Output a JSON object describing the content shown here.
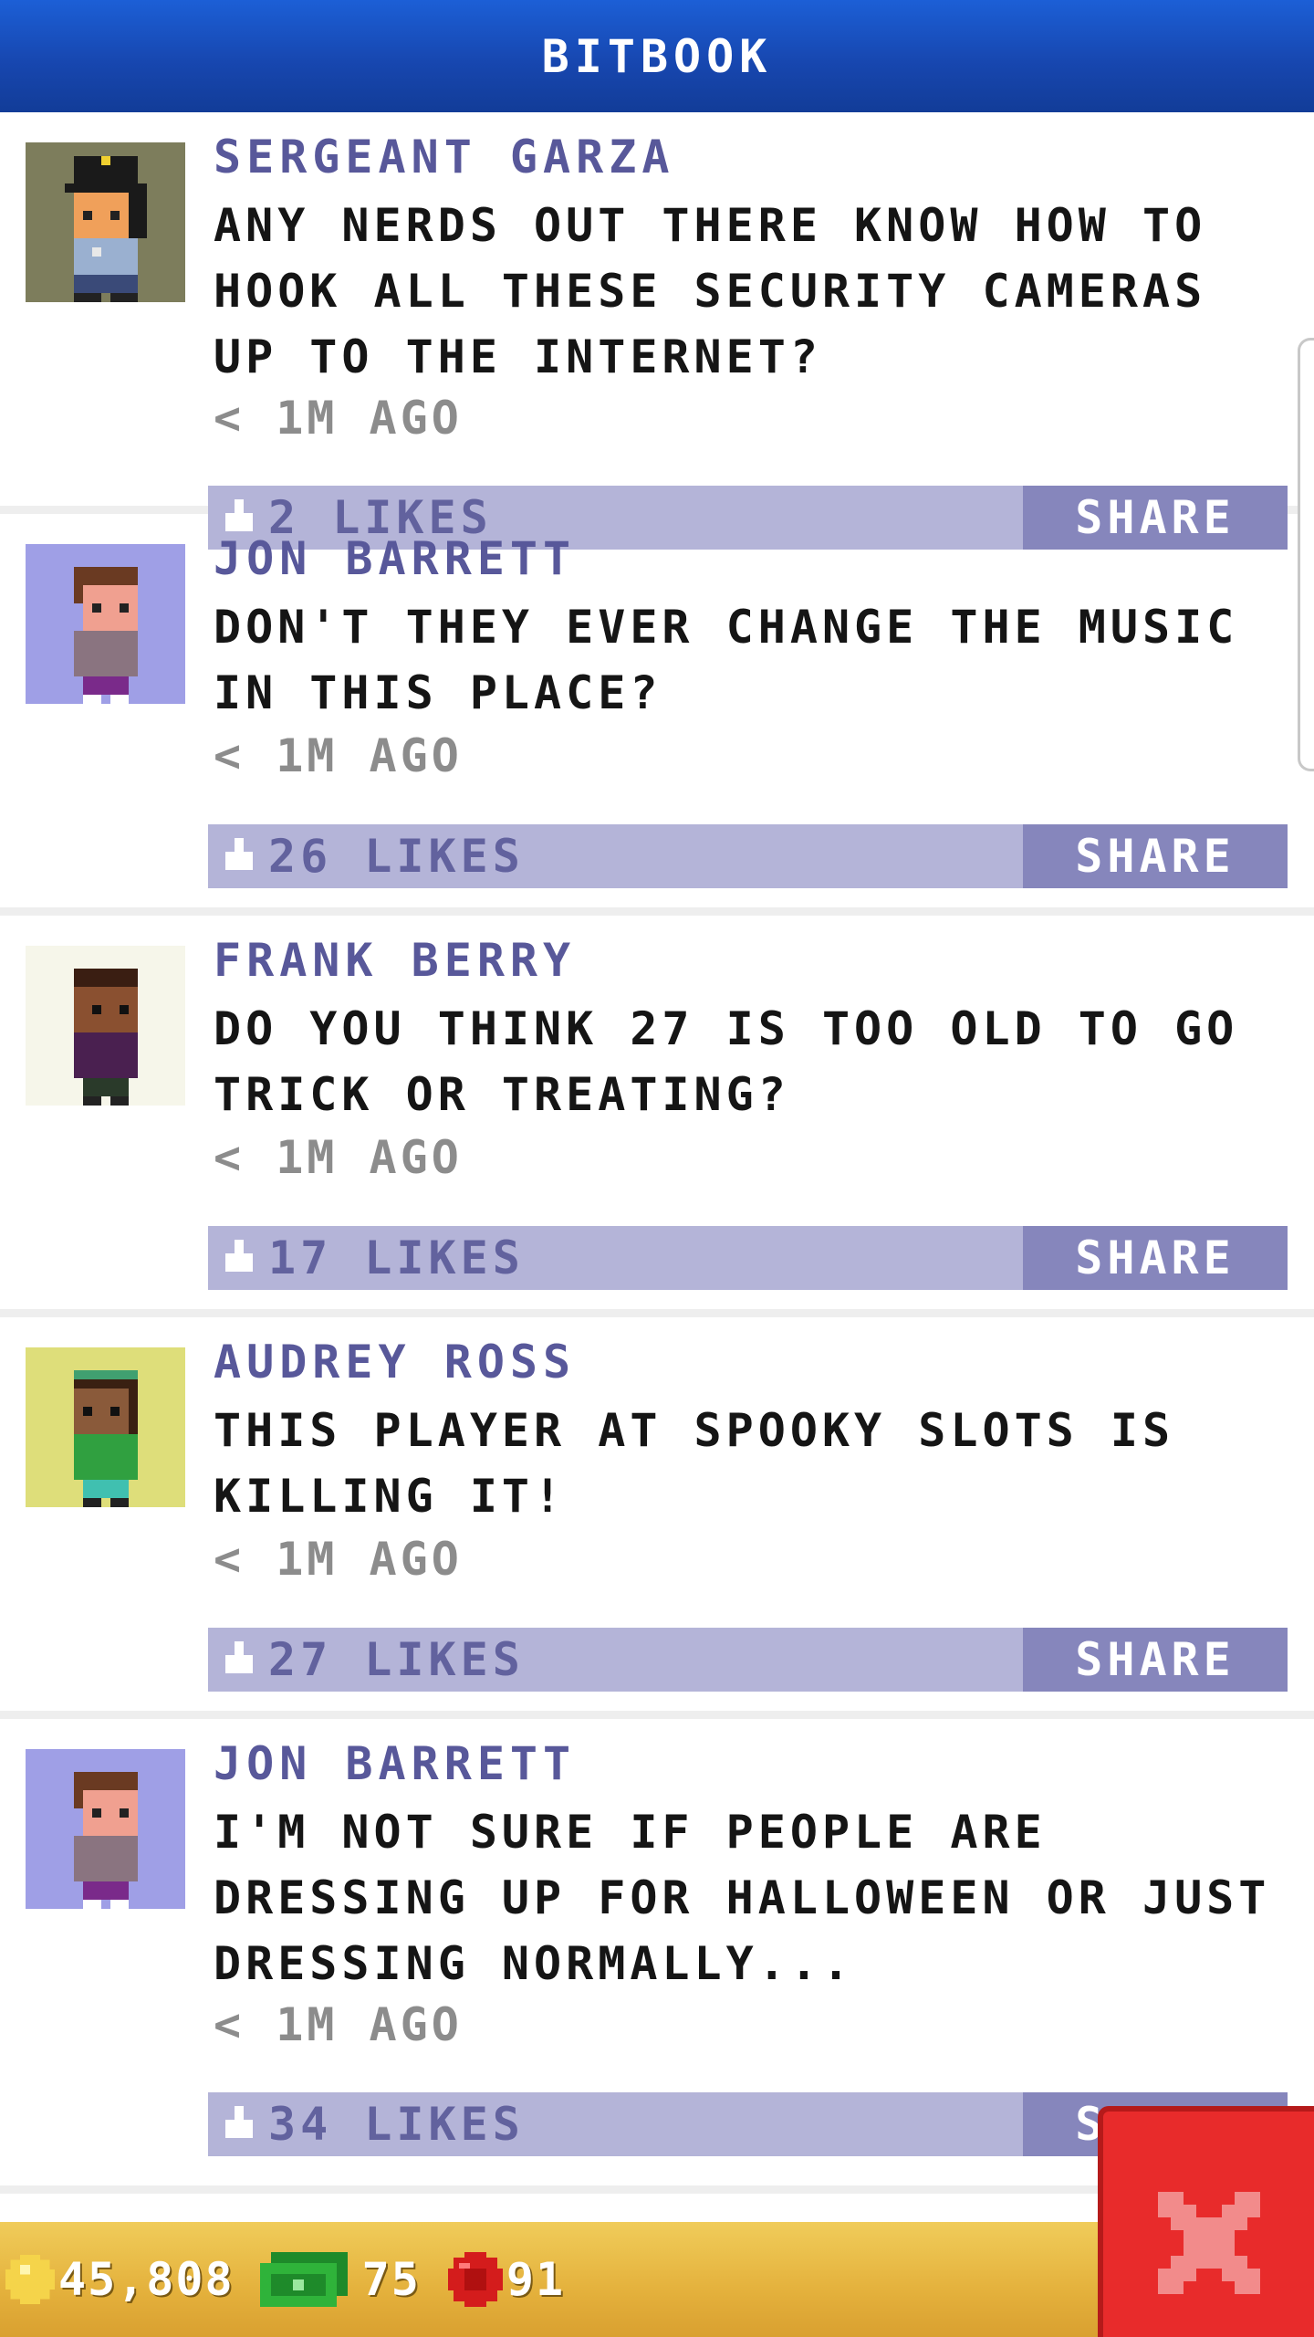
{
  "app": {
    "title": "BITBOOK"
  },
  "posts": [
    {
      "author": "SERGEANT GARZA",
      "message": "ANY NERDS OUT THERE KNOW HOW TO HOOK ALL THESE SECURITY CAMERAS UP TO THE INTERNET?",
      "time": "< 1M AGO",
      "likes": "2 LIKES",
      "share": "SHARE",
      "avatar_bg": "#7d7d5c",
      "avatar_icon": "police-officer-avatar"
    },
    {
      "author": "JON BARRETT",
      "message": "DON'T THEY EVER CHANGE THE MUSIC IN THIS PLACE?",
      "time": "< 1M AGO",
      "likes": "26 LIKES",
      "share": "SHARE",
      "avatar_bg": "#9f9fe6",
      "avatar_icon": "person-avatar"
    },
    {
      "author": "FRANK BERRY",
      "message": "DO YOU THINK 27 IS TOO OLD TO GO TRICK OR TREATING?",
      "time": "< 1M AGO",
      "likes": "17 LIKES",
      "share": "SHARE",
      "avatar_bg": "#f6f6ea",
      "avatar_icon": "person-avatar"
    },
    {
      "author": "AUDREY ROSS",
      "message": "THIS PLAYER AT SPOOKY SLOTS IS KILLING IT!",
      "time": "< 1M AGO",
      "likes": "27 LIKES",
      "share": "SHARE",
      "avatar_bg": "#dede7a",
      "avatar_icon": "person-avatar"
    },
    {
      "author": "JON BARRETT",
      "message": "I'M NOT SURE IF PEOPLE ARE DRESSING UP FOR HALLOWEEN OR JUST DRESSING NORMALLY...",
      "time": "< 1M AGO",
      "likes": "34 LIKES",
      "share": "SHARE",
      "avatar_bg": "#9f9fe6",
      "avatar_icon": "person-avatar"
    }
  ],
  "status_bar": {
    "coins": "45,808",
    "bux": "75",
    "gems": "91"
  }
}
